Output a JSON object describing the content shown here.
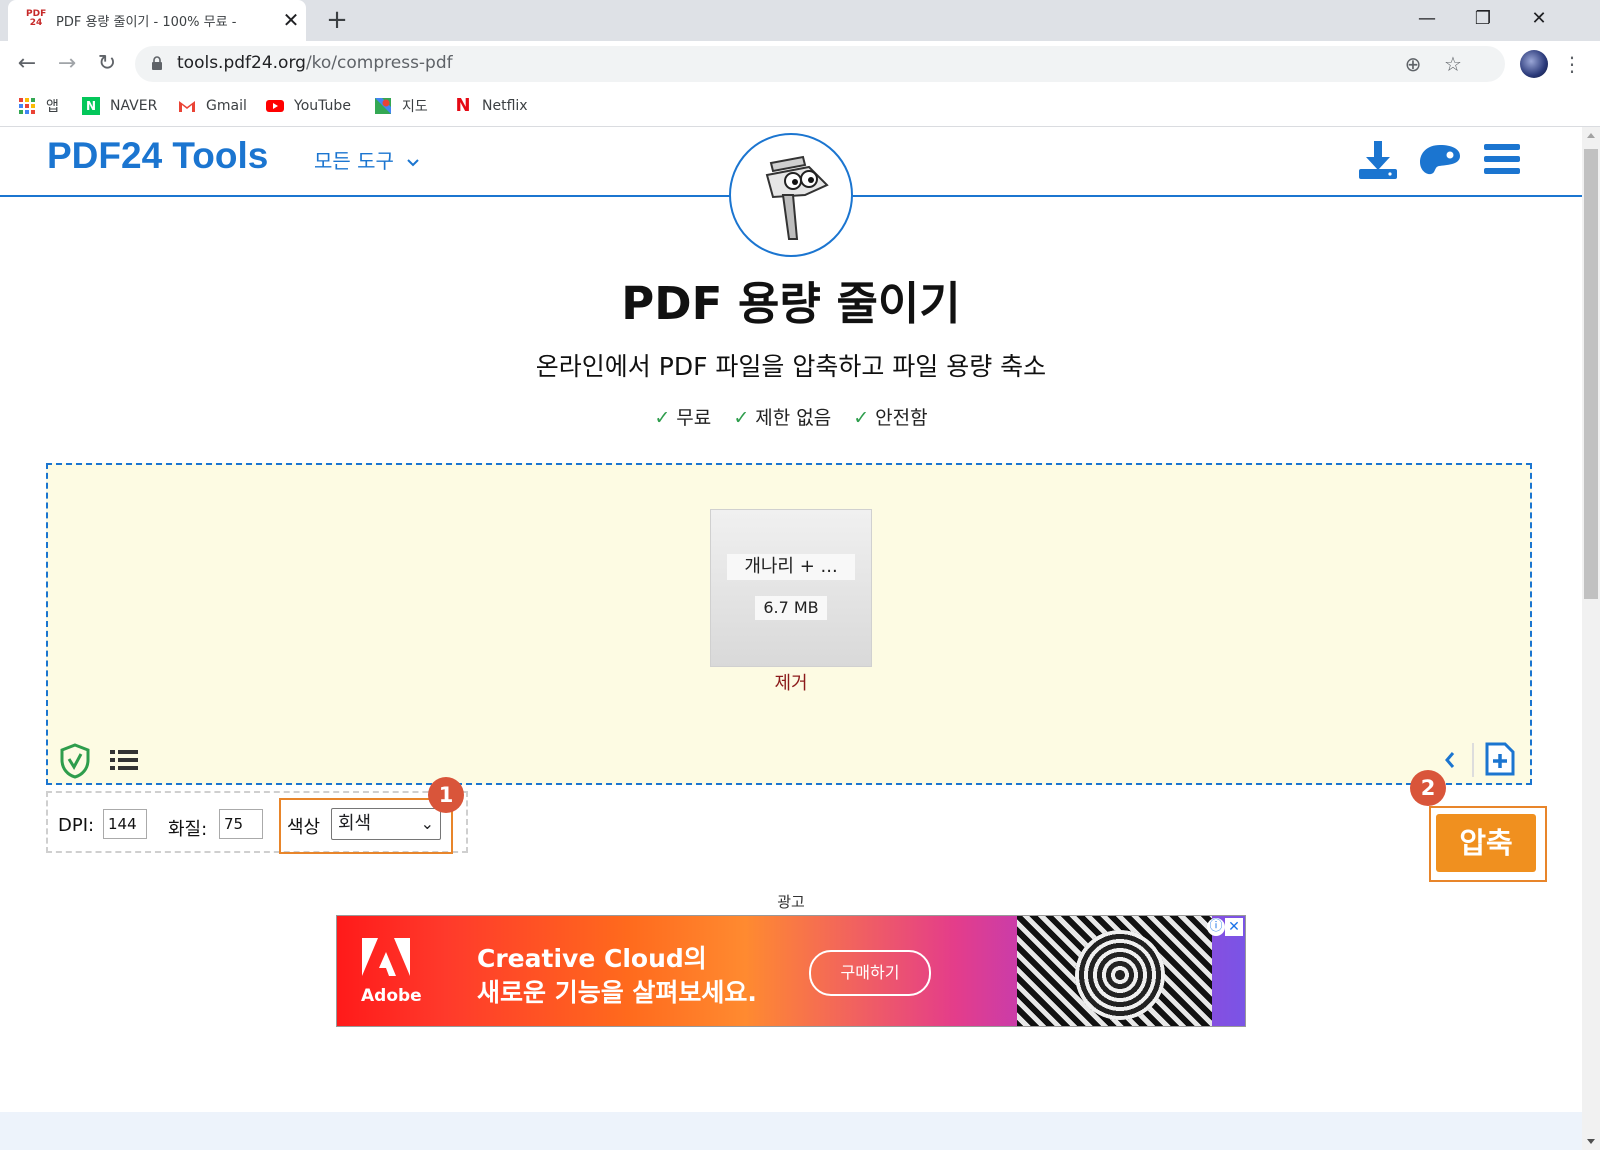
{
  "browser": {
    "tab_title": "PDF 용량 줄이기 - 100% 무료 -",
    "tab_favicon_text": "PDF24",
    "url_host": "tools.pdf24.org",
    "url_path": "/ko/compress-pdf",
    "bookmarks": [
      {
        "label": "앱",
        "icon": "apps-grid-icon"
      },
      {
        "label": "NAVER",
        "icon": "naver-icon"
      },
      {
        "label": "Gmail",
        "icon": "gmail-icon"
      },
      {
        "label": "YouTube",
        "icon": "youtube-icon"
      },
      {
        "label": "지도",
        "icon": "maps-icon"
      },
      {
        "label": "Netflix",
        "icon": "netflix-icon"
      }
    ]
  },
  "site": {
    "brand": "PDF24 Tools",
    "all_tools": "모든 도구",
    "title": "PDF 용량 줄이기",
    "subtitle": "온라인에서 PDF 파일을 압축하고 파일 용량 축소",
    "features": [
      "무료",
      "제한 없음",
      "안전함"
    ]
  },
  "file": {
    "name": "개나리 + ...",
    "size": "6.7 MB",
    "remove_label": "제거"
  },
  "options": {
    "dpi_label": "DPI:",
    "dpi_value": "144",
    "quality_label": "화질:",
    "quality_value": "75",
    "color_label": "색상",
    "color_value": "회색"
  },
  "annotations": {
    "badge1": "1",
    "badge2": "2"
  },
  "compress_label": "압축",
  "ad": {
    "label": "광고",
    "brand": "Adobe",
    "headline_line1": "Creative Cloud의",
    "headline_line2": "새로운 기능을 살펴보세요.",
    "cta": "구매하기"
  },
  "colors": {
    "brand_blue": "#1b75d0",
    "dropzone_bg": "#fdfbe3",
    "compress_orange": "#f0901f",
    "highlight_orange": "#e8852a",
    "badge_red": "#d9553a",
    "remove_red": "#8b1a1a",
    "check_green": "#2e9d4c"
  }
}
